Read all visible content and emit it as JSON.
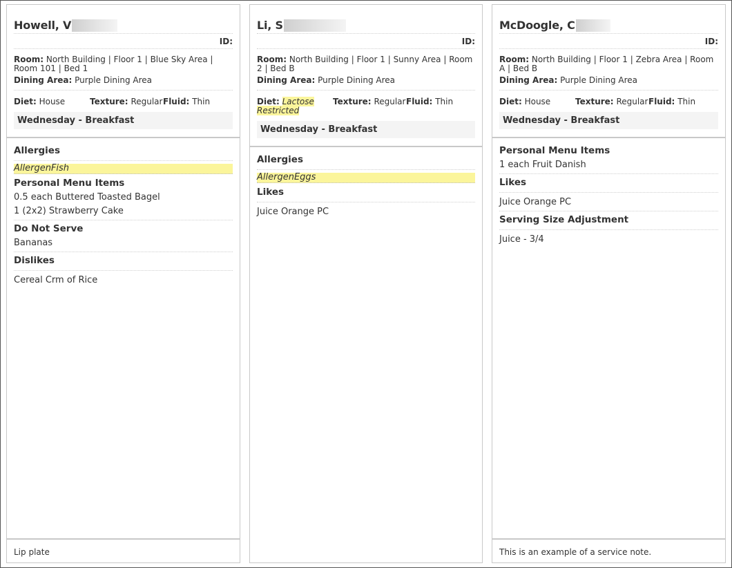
{
  "cards": [
    {
      "name": "Howell, V",
      "id_label": "ID:",
      "room_label": "Room:",
      "room": "North Building | Floor 1 | Blue Sky Area | Room 101 | Bed 1",
      "dining_label": "Dining Area:",
      "dining": "Purple Dining Area",
      "diet_label": "Diet:",
      "diet": "House",
      "texture_label": "Texture:",
      "texture": "Regular",
      "fluid_label": "Fluid:",
      "fluid": "Thin",
      "meal": "Wednesday - Breakfast",
      "allergies_title": "Allergies",
      "allergy": "AllergenFish",
      "pmi_title": "Personal Menu Items",
      "pmi": [
        "0.5 each Buttered Toasted Bagel",
        "1 (2x2) Strawberry Cake"
      ],
      "dns_title": "Do Not Serve",
      "dns": "Bananas",
      "dislikes_title": "Dislikes",
      "dislikes": "Cereal Crm of Rice",
      "note": "Lip plate"
    },
    {
      "name": "Li, S",
      "id_label": "ID:",
      "room_label": "Room:",
      "room": "North Building | Floor 1 | Sunny Area | Room 2 | Bed B",
      "dining_label": "Dining Area:",
      "dining": "Purple Dining Area",
      "diet_label": "Diet:",
      "diet": "Lactose Restricted",
      "texture_label": "Texture:",
      "texture": "Regular",
      "fluid_label": "Fluid:",
      "fluid": "Thin",
      "meal": "Wednesday - Breakfast",
      "allergies_title": "Allergies",
      "allergy": "AllergenEggs",
      "likes_title": "Likes",
      "likes": "Juice Orange PC",
      "note": ""
    },
    {
      "name": "McDoogle, C",
      "id_label": "ID:",
      "room_label": "Room:",
      "room": "North Building | Floor 1 | Zebra Area | Room A | Bed B",
      "dining_label": "Dining Area:",
      "dining": "Purple Dining Area",
      "diet_label": "Diet:",
      "diet": "House",
      "texture_label": "Texture:",
      "texture": "Regular",
      "fluid_label": "Fluid:",
      "fluid": "Thin",
      "meal": "Wednesday - Breakfast",
      "pmi_title": "Personal Menu Items",
      "pmi": [
        "1 each Fruit Danish"
      ],
      "likes_title": "Likes",
      "likes": "Juice Orange PC",
      "ssa_title": "Serving Size Adjustment",
      "ssa": "Juice - 3/4",
      "note": "This is an example of a service note."
    }
  ]
}
